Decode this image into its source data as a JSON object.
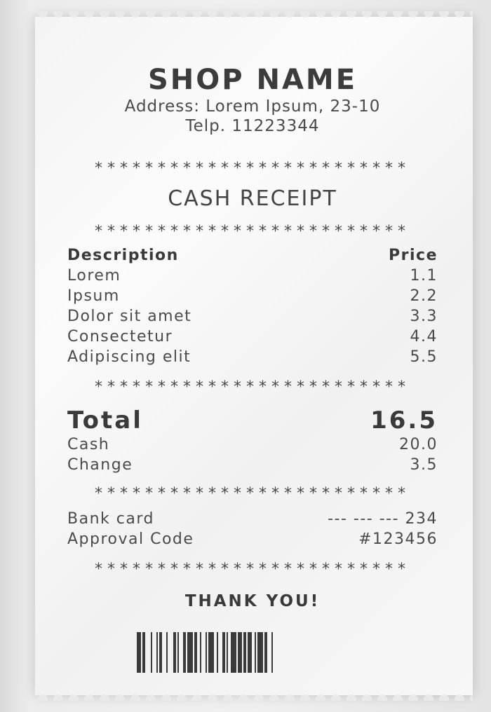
{
  "header": {
    "shop_name": "SHOP NAME",
    "address": "Address: Lorem Ipsum, 23-10",
    "phone": "Telp. 11223344"
  },
  "separator": "*************************",
  "title": "CASH RECEIPT",
  "items_header": {
    "description": "Description",
    "price": "Price"
  },
  "items": [
    {
      "description": "Lorem",
      "price": "1.1"
    },
    {
      "description": "Ipsum",
      "price": "2.2"
    },
    {
      "description": "Dolor sit amet",
      "price": "3.3"
    },
    {
      "description": "Consectetur",
      "price": "4.4"
    },
    {
      "description": "Adipiscing elit",
      "price": "5.5"
    }
  ],
  "totals": {
    "total_label": "Total",
    "total_value": "16.5",
    "cash_label": "Cash",
    "cash_value": "20.0",
    "change_label": "Change",
    "change_value": "3.5"
  },
  "payment": {
    "card_label": "Bank card",
    "card_value": "--- --- --- 234",
    "approval_label": "Approval Code",
    "approval_value": "#123456"
  },
  "footer": {
    "thanks": "THANK YOU!"
  },
  "colors": {
    "ink": "#3a3a3a",
    "paper": "#f6f6f6",
    "background": "#e6e6e6"
  }
}
